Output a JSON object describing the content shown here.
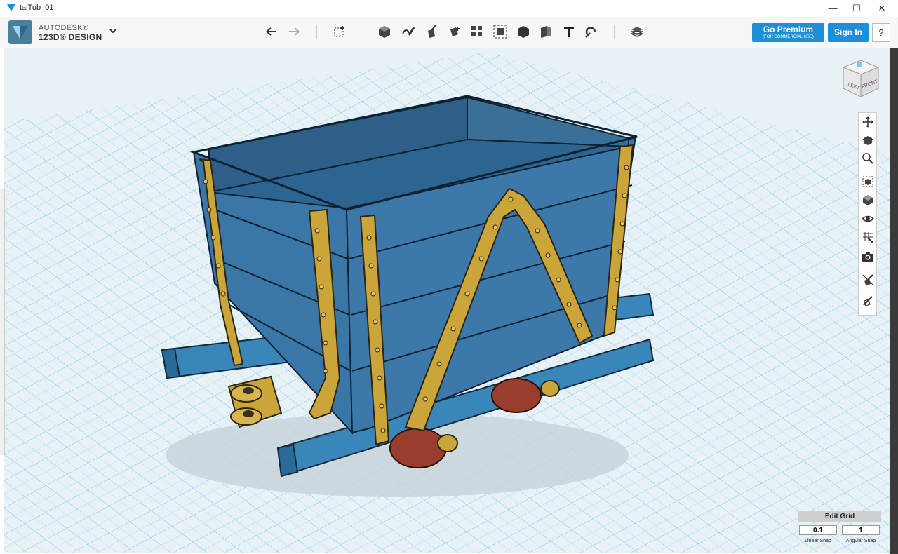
{
  "window": {
    "title": "taiTub_01",
    "minimize": "—",
    "maximize": "☐",
    "close": "✕"
  },
  "brand": {
    "line1": "AUTODESK®",
    "line2": "123D® DESIGN"
  },
  "toolbar": {
    "tools": [
      "undo-icon",
      "redo-icon",
      "transform-icon",
      "primitives-icon",
      "sketch-icon",
      "construct-icon",
      "modify-icon",
      "pattern-icon",
      "grouping-icon",
      "combine-icon",
      "measure-icon",
      "text-icon",
      "snap-icon",
      "material-icon"
    ]
  },
  "premium": {
    "label": "Go Premium",
    "sublabel": "(FOR COMMERCIAL USE)"
  },
  "signin": {
    "label": "Sign In"
  },
  "help": {
    "label": "?"
  },
  "viewcube": {
    "left": "LEFT",
    "front": "FRONT"
  },
  "grid": {
    "edit_label": "Edit Grid",
    "linear_snap": "0.1",
    "angular_snap": "1",
    "linear_label": "Linear Snap",
    "angular_label": "Angular Snap"
  },
  "colors": {
    "accent": "#1c8fd6",
    "tub": "#3b77a6",
    "brass": "#c9a53a",
    "wheel": "#9a3d2c",
    "grid": "#5bc0e8"
  }
}
